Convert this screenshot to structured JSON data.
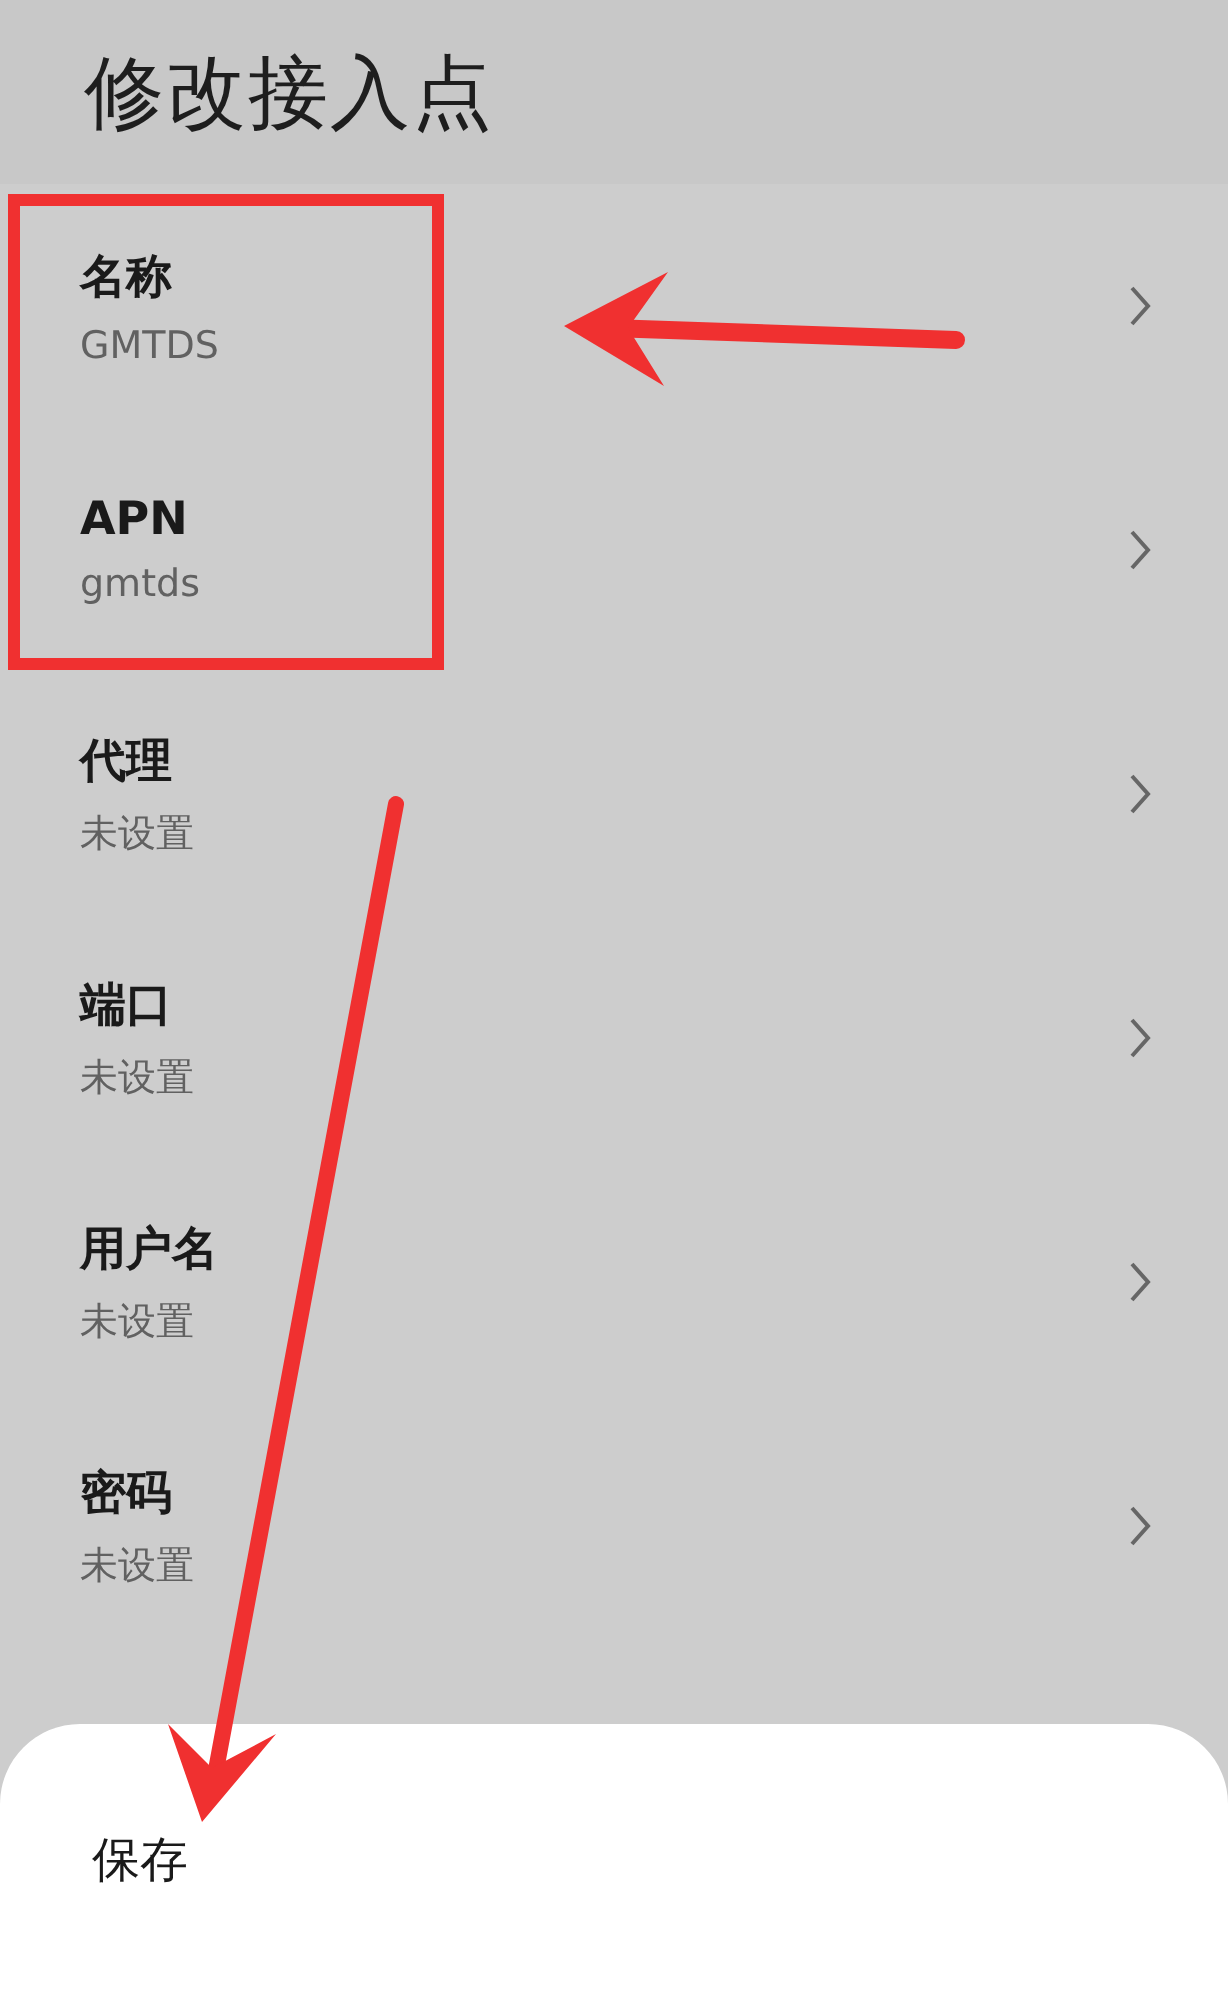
{
  "title": "修改接入点",
  "items": [
    {
      "label": "名称",
      "value": "GMTDS"
    },
    {
      "label": "APN",
      "value": "gmtds"
    },
    {
      "label": "代理",
      "value": "未设置"
    },
    {
      "label": "端口",
      "value": "未设置"
    },
    {
      "label": "用户名",
      "value": "未设置"
    },
    {
      "label": "密码",
      "value": "未设置"
    }
  ],
  "sheet": {
    "action": "保存"
  }
}
